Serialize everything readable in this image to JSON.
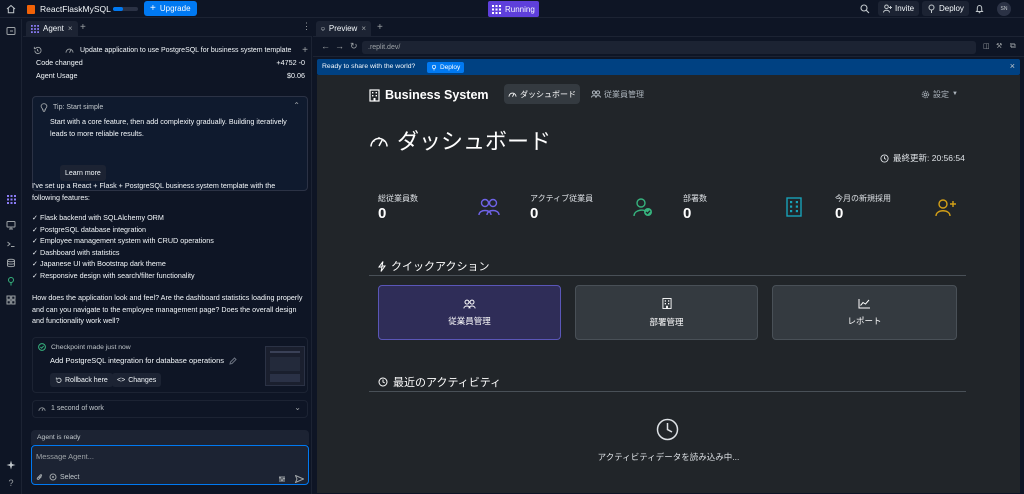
{
  "topbar": {
    "project_name": "ReactFlaskMySQL",
    "upgrade_label": "Upgrade",
    "running_label": "Running",
    "invite_label": "Invite",
    "deploy_label": "Deploy",
    "avatar_initials": "SN"
  },
  "agent": {
    "tab_label": "Agent",
    "history_title": "Update application to use PostgreSQL for business system template",
    "code_changed_label": "Code changed",
    "code_changed_value": "+4752 -0",
    "usage_label": "Agent Usage",
    "usage_value": "$0.06",
    "tip": {
      "title": "Tip: Start simple",
      "body": "Start with a core feature, then add complexity gradually. Building iteratively leads to more reliable results.",
      "button": "Learn more"
    },
    "message_intro": "I've set up a React + Flask + PostgreSQL business system template with the following features:",
    "features": [
      "✓ Flask backend with SQLAlchemy ORM",
      "✓ PostgreSQL database integration",
      "✓ Employee management system with CRUD operations",
      "✓ Dashboard with statistics",
      "✓ Japanese UI with Bootstrap dark theme",
      "✓ Responsive design with search/filter functionality"
    ],
    "question": "How does the application look and feel? Are the dashboard statistics loading properly and can you navigate to the employee management page? Does the overall design and functionality work well?",
    "checkpoint": {
      "status": "Checkpoint made just now",
      "title": "Add PostgreSQL integration for database operations",
      "rollback_label": "Rollback here",
      "changes_label": "Changes"
    },
    "work_label": "1 second of work",
    "ready_label": "Agent is ready",
    "input_placeholder": "Message Agent...",
    "select_label": "Select"
  },
  "preview": {
    "tab_label": "Preview",
    "url": ".replit.dev/",
    "banner_text": "Ready to share with the world?",
    "banner_button": "Deploy"
  },
  "app": {
    "brand": "Business System",
    "nav": {
      "dashboard": "ダッシュボード",
      "employees": "従業員管理",
      "settings": "設定"
    },
    "page_title": "ダッシュボード",
    "last_updated": "最終更新: 20:56:54",
    "stats": [
      {
        "label": "総従業員数",
        "value": "0",
        "color": "#6f63e8"
      },
      {
        "label": "アクティブ従業員",
        "value": "0",
        "color": "#36b37e"
      },
      {
        "label": "部署数",
        "value": "0",
        "color": "#17a2b8"
      },
      {
        "label": "今月の新規採用",
        "value": "0",
        "color": "#d4a017"
      }
    ],
    "quick_actions_title": "クイックアクション",
    "quick_actions": [
      "従業員管理",
      "部署管理",
      "レポート"
    ],
    "activity_title": "最近のアクティビティ",
    "activity_loading": "アクティビティデータを読み込み中..."
  }
}
